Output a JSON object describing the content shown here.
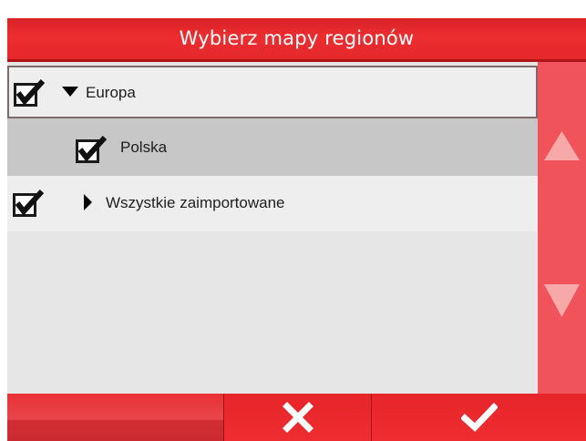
{
  "header": {
    "title": "Wybierz mapy regionów"
  },
  "tree": {
    "items": [
      {
        "label": "Europa",
        "checked": true,
        "expander": "triangle-down-icon",
        "selected": true
      },
      {
        "label": "Polska",
        "checked": true,
        "expander": null,
        "selected": false
      },
      {
        "label": "Wszystkie zaimportowane",
        "checked": true,
        "expander": "triangle-right-icon",
        "selected": false
      }
    ]
  },
  "scrollbar": {
    "up_icon": "triangle-up-icon",
    "down_icon": "triangle-down-icon"
  },
  "footer": {
    "cancel_icon": "close-icon",
    "confirm_icon": "checkmark-icon"
  },
  "colors": {
    "accent": "#e8282d",
    "scrollbar": "#f0545a",
    "selected_row": "#c7c7c7",
    "list_bg": "#e6e6e6"
  }
}
